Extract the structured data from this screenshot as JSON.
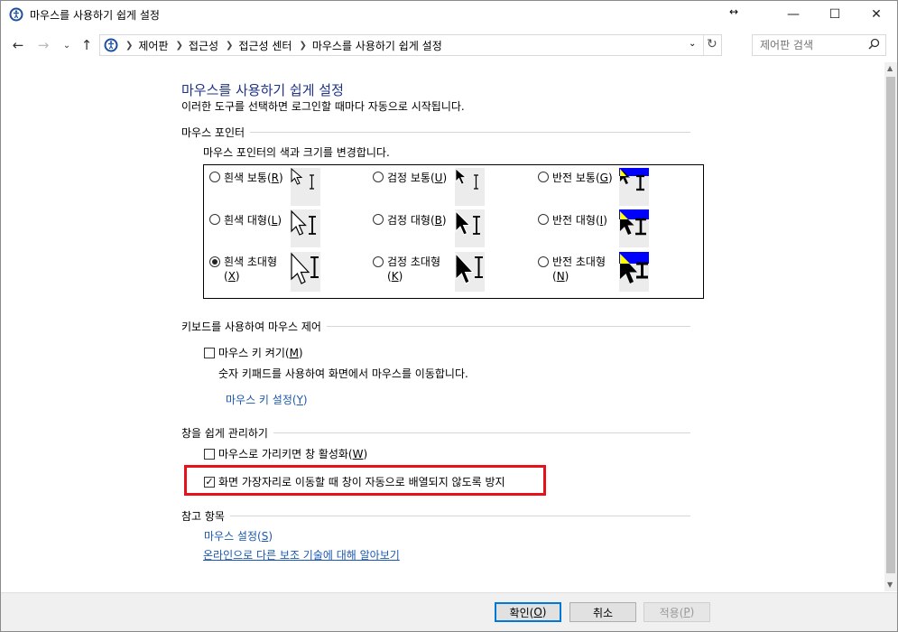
{
  "window": {
    "title": "마우스를 사용하기 쉽게 설정",
    "controls": {
      "minimize": "—",
      "maximize": "☐",
      "close": "✕",
      "resize": "↔"
    }
  },
  "nav": {
    "breadcrumb": [
      "제어판",
      "접근성",
      "접근성 센터",
      "마우스를 사용하기 쉽게 설정"
    ],
    "search_placeholder": "제어판 검색"
  },
  "page": {
    "title": "마우스를 사용하기 쉽게 설정",
    "subtitle": "이러한 도구를 선택하면 로그인할 때마다 자동으로 시작됩니다."
  },
  "pointers": {
    "header": "마우스 포인터",
    "description": "마우스 포인터의 색과 크기를 변경합니다.",
    "options": [
      {
        "label": "흰색 보통(",
        "key": "R",
        "end": ")",
        "selected": false
      },
      {
        "label": "검정 보통(",
        "key": "U",
        "end": ")",
        "selected": false
      },
      {
        "label": "반전 보통(",
        "key": "G",
        "end": ")",
        "selected": false
      },
      {
        "label": "흰색 대형(",
        "key": "L",
        "end": ")",
        "selected": false
      },
      {
        "label": "검정 대형(",
        "key": "B",
        "end": ")",
        "selected": false
      },
      {
        "label": "반전 대형(",
        "key": "I",
        "end": ")",
        "selected": false
      },
      {
        "label": "흰색 초대형",
        "key": "X",
        "selected": true
      },
      {
        "label": "검정 초대형",
        "key": "K",
        "selected": false
      },
      {
        "label": "반전 초대형",
        "key": "N",
        "selected": false
      }
    ]
  },
  "keyboard": {
    "header": "키보드를 사용하여 마우스 제어",
    "mousekeys_label": "마우스 키 켜기(",
    "mousekeys_key": "M",
    "mousekeys_checked": false,
    "mousekeys_desc": "숫자 키패드를 사용하여 화면에서 마우스를 이동합니다.",
    "settings_link": "마우스 키 설정(",
    "settings_key": "Y"
  },
  "windows": {
    "header": "창을 쉽게 관리하기",
    "hover_activate_label": "마우스로 가리키면 창 활성화(",
    "hover_activate_key": "W",
    "hover_activate_checked": false,
    "prevent_arrange_label": "화면 가장자리로 이동할 때 창이 자동으로 배열되지 않도록 방지",
    "prevent_arrange_checked": true
  },
  "see_also": {
    "header": "참고 항목",
    "mouse_settings": "마우스 설정(",
    "mouse_settings_key": "S",
    "learn_more": "온라인으로 다른 보조 기술에 대해 알아보기"
  },
  "footer": {
    "ok_label": "확인(",
    "ok_key": "O",
    "cancel_label": "취소",
    "apply_label": "적용(",
    "apply_key": "P"
  },
  "colors": {
    "link": "#1a58b0",
    "title": "#1e3287",
    "highlight": "#e8101a",
    "accent": "#0078d7"
  }
}
